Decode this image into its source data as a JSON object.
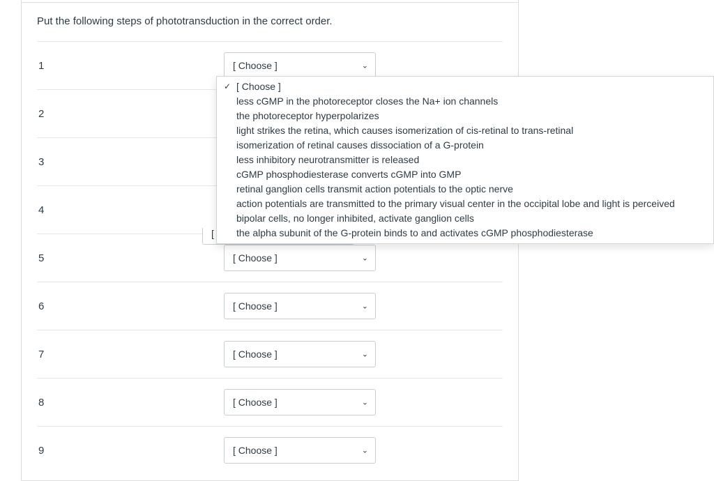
{
  "question": {
    "text": "Put the following steps of phototransduction in the correct order."
  },
  "steps": [
    {
      "num": "1"
    },
    {
      "num": "2"
    },
    {
      "num": "3"
    },
    {
      "num": "4"
    },
    {
      "num": "5"
    },
    {
      "num": "6"
    },
    {
      "num": "7"
    },
    {
      "num": "8"
    },
    {
      "num": "9"
    }
  ],
  "select_placeholder": "[ Choose ]",
  "dropdown": {
    "options": [
      {
        "label": "[ Choose ]",
        "checked": true
      },
      {
        "label": "less cGMP in the photoreceptor closes the Na+ ion channels",
        "checked": false
      },
      {
        "label": "the photoreceptor hyperpolarizes",
        "checked": false
      },
      {
        "label": "light strikes the retina, which causes isomerization of cis-retinal to trans-retinal",
        "checked": false
      },
      {
        "label": "isomerization of retinal causes dissociation of a G-protein",
        "checked": false
      },
      {
        "label": "less inhibitory neurotransmitter is released",
        "checked": false
      },
      {
        "label": "cGMP phosphodiesterase converts cGMP into GMP",
        "checked": false
      },
      {
        "label": "retinal ganglion cells transmit action potentials to the optic nerve",
        "checked": false
      },
      {
        "label": "action potentials are transmitted to the primary visual center in the occipital lobe and light is perceived",
        "checked": false
      },
      {
        "label": "bipolar cells, no longer inhibited, activate ganglion cells",
        "checked": false
      },
      {
        "label": "the alpha subunit of the G-protein binds to and activates cGMP phosphodiesterase",
        "checked": false
      }
    ]
  }
}
